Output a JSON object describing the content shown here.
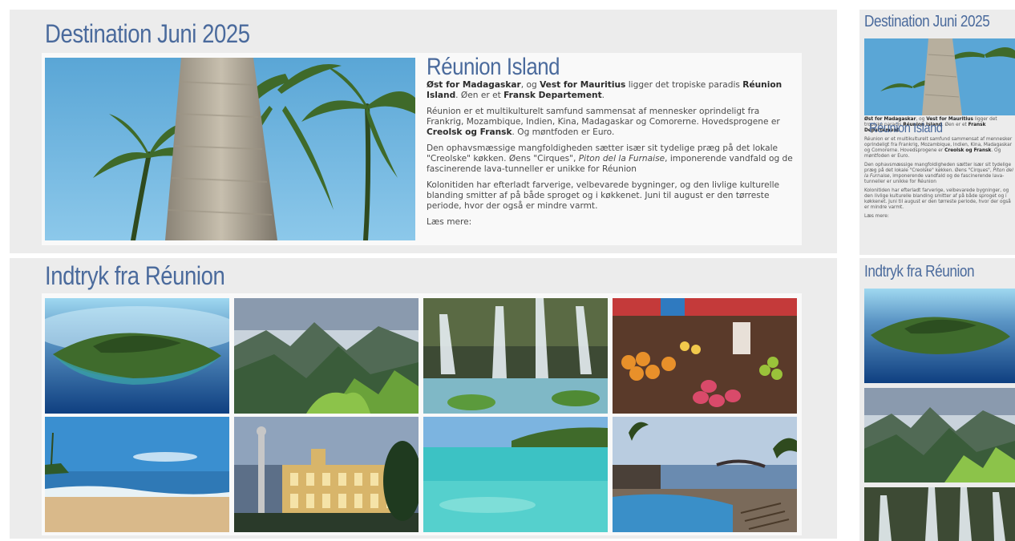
{
  "destination": {
    "heading": "Destination Juni 2025",
    "photo_alt": "palm-trees-photo"
  },
  "reunion": {
    "title": "Réunion Island",
    "p1": {
      "b1": "Øst for Madagaskar",
      "t1": ", og ",
      "b2": "Vest for Mauritius",
      "t2": " ligger det tropiske paradis ",
      "b3": "Réunion Island",
      "t3": ". Øen er et ",
      "b4": "Fransk Departement",
      "t4": "."
    },
    "p2": {
      "t1": "Réunion er et multikulturelt samfund sammensat af mennesker oprindeligt fra Frankrig, Mozambique, Indien, Kina, Madagaskar og Comorerne. Hovedsprogene er ",
      "b1": "Creolsk og Fransk",
      "t2": ". Og møntfoden er Euro."
    },
    "p3": {
      "t1": "Den ophavsmæssige mangfoldigheden sætter især sit tydelige præg på det lokale \"Creolske\" køkken. Øens \"Cirques\", ",
      "i1": "Piton del la Furnaise",
      "t2": ", imponerende vandfald og de fascinerende lava-tunneller er unikke for Réunion"
    },
    "p4": "Kolonitiden har efterladt farverige, velbevarede bygninger, og den livlige kulturelle blanding smitter af på både sproget og i køkkenet. Juni til august er den tørreste periode, hvor der også er mindre varmt.",
    "read_more": "Læs mere:"
  },
  "impressions": {
    "heading": "Indtryk fra Réunion",
    "images": [
      "island-aerial-photo",
      "mountains-photo",
      "waterfall-photo",
      "market-photo",
      "beach-photo",
      "colonial-building-photo",
      "lagoon-photo",
      "resort-pool-photo"
    ]
  },
  "colors": {
    "heading": "#4a6a9c",
    "panel": "#ececec",
    "card": "#f9f9f9"
  }
}
